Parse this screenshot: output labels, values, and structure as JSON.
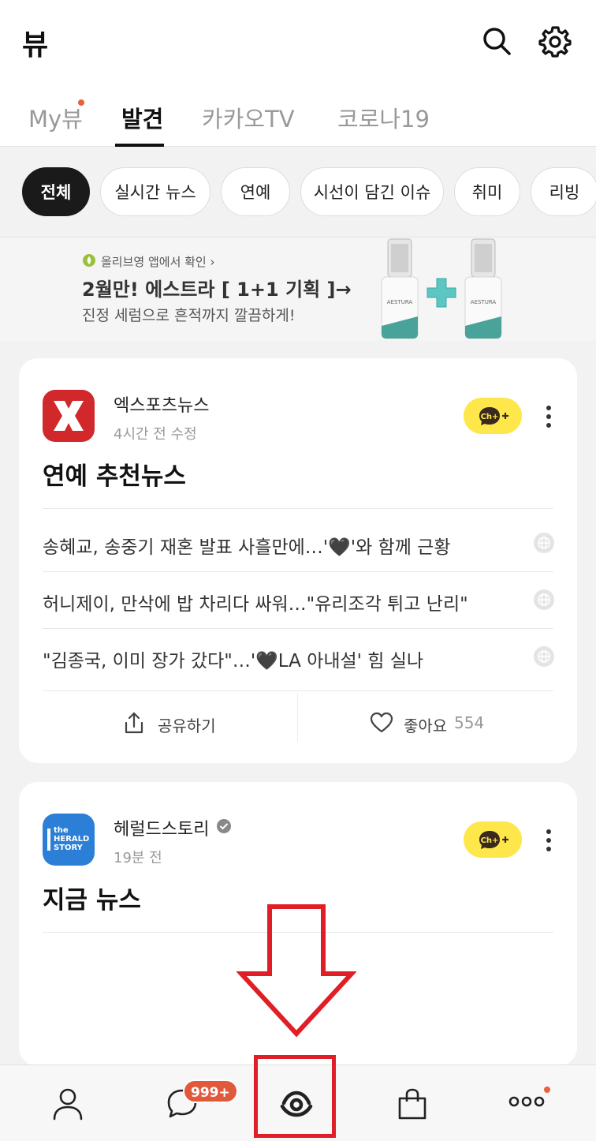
{
  "header": {
    "title": "뷰",
    "icons": [
      "search-icon",
      "gear-icon"
    ]
  },
  "tabs": [
    {
      "label": "My뷰",
      "active": false,
      "has_dot": true
    },
    {
      "label": "발견",
      "active": true
    },
    {
      "label": "카카오TV",
      "active": false
    },
    {
      "label": "코로나19",
      "active": false
    }
  ],
  "chips": [
    {
      "label": "전체",
      "active": true
    },
    {
      "label": "실시간 뉴스"
    },
    {
      "label": "연예"
    },
    {
      "label": "시선이 담긴 이슈"
    },
    {
      "label": "취미"
    },
    {
      "label": "리빙"
    }
  ],
  "ad": {
    "source": "올리브영 앱에서 확인 ›",
    "title": "2월만! 에스트라 [ 1+1 기획 ]→",
    "subtitle": "진정 세럼으로 흔적까지 깔끔하게!"
  },
  "cards": [
    {
      "publisher": "엑스포츠뉴스",
      "time": "4시간 전 수정",
      "channel_button": "Ch+",
      "title": "연예 추천뉴스",
      "items": [
        "송혜교, 송중기 재혼 발표 사흘만에…'🖤'와 함께 근황",
        "허니제이, 만삭에 밥 차리다 싸워…\"유리조각 튀고 난리\"",
        "\"김종국, 이미 장가 갔다\"…'🖤LA 아내설' 힘 실나"
      ],
      "share_label": "공유하기",
      "like_label": "좋아요",
      "like_count": "554"
    },
    {
      "publisher": "헤럴드스토리",
      "time": "19분 전",
      "channel_button": "Ch+",
      "title": "지금 뉴스",
      "logo_text": "the HERALD STORY"
    }
  ],
  "bottom_nav": {
    "items": [
      "person-icon",
      "chat-icon",
      "view-eye-icon",
      "shopping-bag-icon",
      "more-dots-icon"
    ],
    "chat_badge": "999+"
  },
  "colors": {
    "accent_dot": "#e8603c",
    "channel_yellow": "#fde74a",
    "annotation_red": "#e01e26",
    "badge": "#e0593a"
  }
}
